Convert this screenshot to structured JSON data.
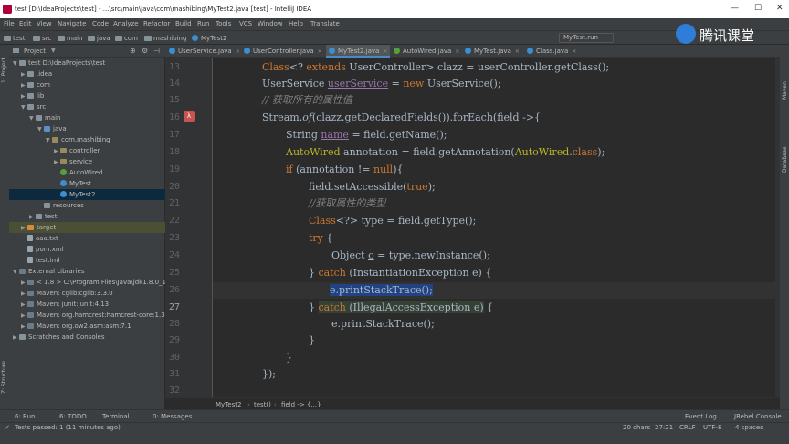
{
  "window": {
    "title": "test [D:\\IdeaProjects\\test] - ...\\src\\main\\java\\com\\mashibing\\MyTest2.java [test] - IntelliJ IDEA"
  },
  "menu": [
    "File",
    "Edit",
    "View",
    "Navigate",
    "Code",
    "Analyze",
    "Refactor",
    "Build",
    "Run",
    "Tools",
    "VCS",
    "Window",
    "Help",
    "Translate"
  ],
  "navbar": {
    "crumbs": [
      "test",
      "src",
      "main",
      "java",
      "com",
      "mashibing",
      "MyTest2"
    ],
    "run_config": "MyTest.run"
  },
  "watermark": "腾讯课堂",
  "project": {
    "header": "Project",
    "tree": [
      {
        "label": "test  D:\\IdeaProjects\\test",
        "depth": 0,
        "arrow": "▼",
        "icon": "folder"
      },
      {
        "label": ".idea",
        "depth": 1,
        "arrow": "▶",
        "icon": "folder"
      },
      {
        "label": "com",
        "depth": 1,
        "arrow": "▶",
        "icon": "folder"
      },
      {
        "label": "lib",
        "depth": 1,
        "arrow": "▶",
        "icon": "folder"
      },
      {
        "label": "src",
        "depth": 1,
        "arrow": "▼",
        "icon": "folder"
      },
      {
        "label": "main",
        "depth": 2,
        "arrow": "▼",
        "icon": "folder"
      },
      {
        "label": "java",
        "depth": 3,
        "arrow": "▼",
        "icon": "src"
      },
      {
        "label": "com.mashibing",
        "depth": 4,
        "arrow": "▼",
        "icon": "pkg"
      },
      {
        "label": "controller",
        "depth": 5,
        "arrow": "▶",
        "icon": "pkg"
      },
      {
        "label": "service",
        "depth": 5,
        "arrow": "▶",
        "icon": "pkg"
      },
      {
        "label": "AutoWired",
        "depth": 5,
        "arrow": "",
        "icon": "annot"
      },
      {
        "label": "MyTest",
        "depth": 5,
        "arrow": "",
        "icon": "class"
      },
      {
        "label": "MyTest2",
        "depth": 5,
        "arrow": "",
        "icon": "class",
        "selected": true
      },
      {
        "label": "resources",
        "depth": 3,
        "arrow": "",
        "icon": "folder"
      },
      {
        "label": "test",
        "depth": 2,
        "arrow": "▶",
        "icon": "folder"
      },
      {
        "label": "target",
        "depth": 1,
        "arrow": "▶",
        "icon": "target",
        "highlight": true
      },
      {
        "label": "aaa.txt",
        "depth": 1,
        "arrow": "",
        "icon": "file"
      },
      {
        "label": "pom.xml",
        "depth": 1,
        "arrow": "",
        "icon": "file"
      },
      {
        "label": "test.iml",
        "depth": 1,
        "arrow": "",
        "icon": "file"
      },
      {
        "label": "External Libraries",
        "depth": 0,
        "arrow": "▼",
        "icon": "lib"
      },
      {
        "label": "< 1.8 >  C:\\Program Files\\Java\\jdk1.8.0_17",
        "depth": 1,
        "arrow": "▶",
        "icon": "lib"
      },
      {
        "label": "Maven: cglib:cglib:3.3.0",
        "depth": 1,
        "arrow": "▶",
        "icon": "lib"
      },
      {
        "label": "Maven: junit:junit:4.13",
        "depth": 1,
        "arrow": "▶",
        "icon": "lib"
      },
      {
        "label": "Maven: org.hamcrest:hamcrest-core:1.3",
        "depth": 1,
        "arrow": "▶",
        "icon": "lib"
      },
      {
        "label": "Maven: org.ow2.asm:asm:7.1",
        "depth": 1,
        "arrow": "▶",
        "icon": "lib"
      },
      {
        "label": "Scratches and Consoles",
        "depth": 0,
        "arrow": "▶",
        "icon": "folder"
      }
    ]
  },
  "tabs": [
    {
      "label": "UserService.java",
      "active": false
    },
    {
      "label": "UserController.java",
      "active": false
    },
    {
      "label": "MyTest2.java",
      "active": true
    },
    {
      "label": "AutoWired.java",
      "active": false
    },
    {
      "label": "MyTest.java",
      "active": false
    },
    {
      "label": "Class.java",
      "active": false
    }
  ],
  "editor": {
    "line_numbers": [
      "13",
      "14",
      "15",
      "16",
      "17",
      "18",
      "19",
      "20",
      "21",
      "22",
      "23",
      "24",
      "25",
      "26",
      "27",
      "28",
      "29",
      "30",
      "31",
      "32",
      "33"
    ],
    "caret_line": "27",
    "lines": [
      "Class<? extends UserController> clazz = userController.getClass();",
      "UserService userService = new UserService();",
      "// 获取所有的属性值",
      "Stream.of(clazz.getDeclaredFields()).forEach(field ->{",
      "String name = field.getName();",
      "AutoWired annotation = field.getAnnotation(AutoWired.class);",
      "if (annotation != null){",
      "field.setAccessible(true);",
      "//获取属性的类型",
      "Class<?> type = field.getType();",
      "try {",
      "Object o = type.newInstance();",
      "} catch (InstantiationException e) {",
      "e.printStackTrace();",
      "} catch (IllegalAccessException e) {",
      "e.printStackTrace();",
      "}",
      "}",
      "});",
      "",
      ""
    ]
  },
  "editor_breadcrumbs": [
    "MyTest2",
    "test()",
    "field -> {...}"
  ],
  "bottom_tools": [
    "6: Run",
    "6: TODO",
    "Terminal",
    "0: Messages",
    "Event Log",
    "JRebel Console"
  ],
  "status": {
    "message": "Tests passed: 1 (11 minutes ago)",
    "chars": "20 chars",
    "position": "27:21",
    "line_sep": "CRLF",
    "encoding": "UTF-8",
    "indent": "4 spaces"
  }
}
